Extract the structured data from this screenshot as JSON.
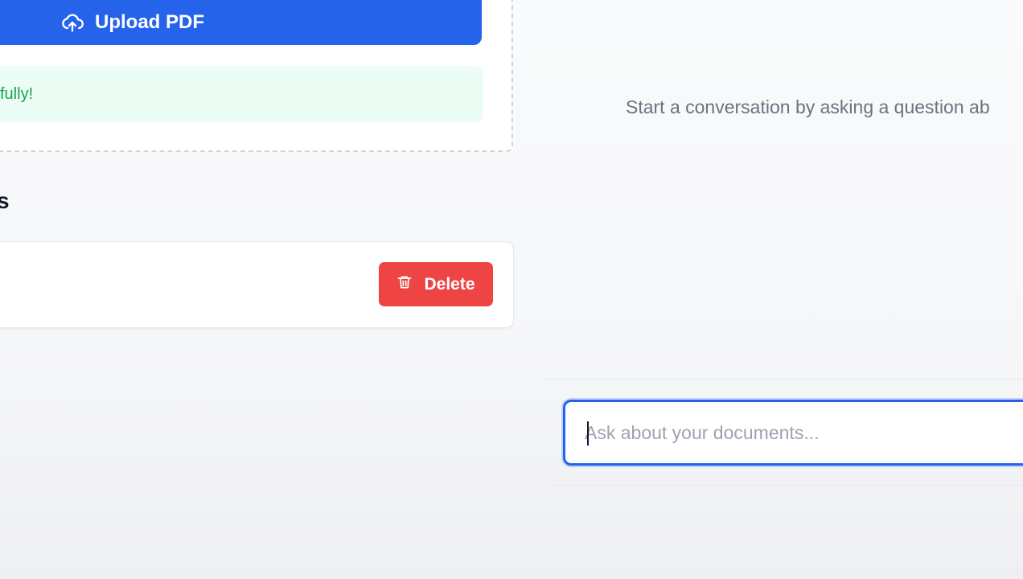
{
  "upload": {
    "button_label": "Upload PDF",
    "icon": "cloud-upload-icon",
    "success_message": "fully!"
  },
  "documents": {
    "heading": "s",
    "delete_label": "Delete",
    "delete_icon": "trash-icon"
  },
  "chat": {
    "empty_message": "Start a conversation by asking a question ab",
    "input_placeholder": "Ask about your documents...",
    "input_value": ""
  },
  "colors": {
    "primary": "#2563eb",
    "danger": "#ef4444",
    "success_bg": "#ecfdf5",
    "success_text": "#16a34a"
  }
}
